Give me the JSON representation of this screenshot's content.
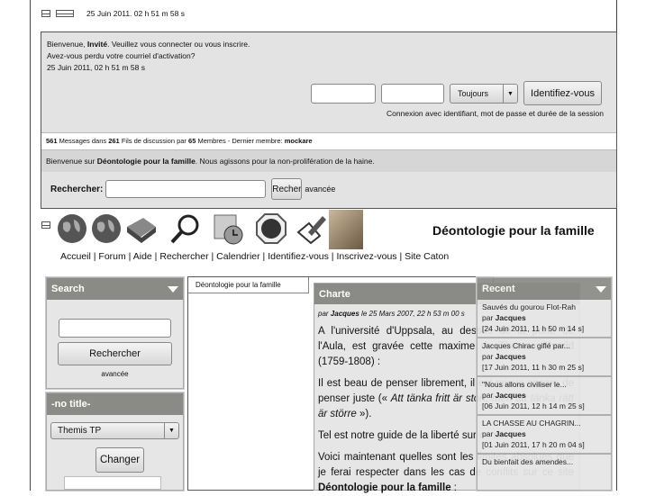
{
  "header": {
    "datetime": "25 Juin 2011. 02 h 51 m 58 s"
  },
  "login": {
    "welcome_prefix": "Bienvenue, ",
    "guest": "Invité",
    "welcome_suffix": ". Veuillez vous connecter ou vous inscrire.",
    "lost_activation": "Avez-vous perdu votre courriel d'activation?",
    "datetime": "25 Juin 2011, 02 h 51 m 58 s",
    "username_value": "",
    "password_value": "",
    "duration_select": "Toujours",
    "login_button": "Identifiez-vous",
    "hint": "Connexion avec identifiant, mot de passe et durée de la session"
  },
  "stats": {
    "messages": "561",
    "messages_label": " Messages dans ",
    "threads": "261",
    "threads_label": " Fils de discussion par ",
    "members": "65",
    "members_label": " Membres - Dernier membre: ",
    "latest_member": "mockare"
  },
  "welcome": {
    "prefix": "Bienvenue sur ",
    "site": "Déontologie pour la famille",
    "suffix": ". Nous agissons pour la non-prolifération de la haine."
  },
  "search_bar": {
    "label": "Rechercher:",
    "value": "",
    "button": "Recher",
    "advanced": "avancée"
  },
  "site_title": "Déontologie pour la famille",
  "icons": [
    "globe-icon",
    "globe-icon",
    "book-icon",
    "magnifier-icon",
    "calendar-clock-icon",
    "stop-icon",
    "pen-paper-icon",
    "portrait-bust-image"
  ],
  "nav": [
    {
      "label": "Accueil"
    },
    {
      "label": "Forum"
    },
    {
      "label": "Aide"
    },
    {
      "label": "Rechercher"
    },
    {
      "label": "Calendrier"
    },
    {
      "label": "Identifiez-vous"
    },
    {
      "label": "Inscrivez-vous"
    },
    {
      "label": "Site Caton"
    }
  ],
  "left": {
    "search_title": "Search",
    "search_value": "",
    "search_button": "Rechercher",
    "advanced": "avancée",
    "theme_title": "-no title-",
    "theme_select": "Themis TP",
    "change_button": "Changer"
  },
  "tab": {
    "label": "Déontologie pour la famille"
  },
  "charte": {
    "title": "Charte",
    "by": "par ",
    "author": "Jacques",
    "date": " le 25 Mars 2007, 22 h 53 m 00 s",
    "p1": "A l'université d'Uppsala, au dessus de la porte de l'Aula, est gravée cette maxime de Thomas Thorild (1759-1808) :",
    "p2_a": "Il est beau de penser librement, il est mieux encore de penser juste (« ",
    "p2_quote": "Att tänka fritt är stort, men att tänka rätt är större",
    "p2_b": " »).",
    "p3": "Tel est notre guide de la liberté sur ce site.",
    "p4": "Voici maintenant quelles sont les limites absolues que je ferai respecter dans les cas de conflits sur ce site ",
    "p4_site": "Déontologie pour la famille",
    "p4_end": " :"
  },
  "recent": {
    "title": "Recent",
    "items": [
      {
        "title": "Sauvés du gourou Flot-Rah",
        "by": "par ",
        "author": "Jacques",
        "date": "[24 Juin 2011, 11 h 50 m 14 s]"
      },
      {
        "title": "Jacques Chirac giflé par...",
        "by": "par ",
        "author": "Jacques",
        "date": "[17 Juin 2011, 11 h 30 m 25 s]"
      },
      {
        "title": "\"Nous allons civiliser le...",
        "by": "par ",
        "author": "Jacques",
        "date": "[06 Juin 2011, 12 h 14 m 25 s]"
      },
      {
        "title": "LA CHASSE AU CHAGRIN...",
        "by": "par ",
        "author": "Jacques",
        "date": "[01 Juin 2011, 17 h 20 m 04 s]"
      },
      {
        "title": "Du bienfait des amendes...",
        "by": "",
        "author": "",
        "date": ""
      }
    ]
  }
}
